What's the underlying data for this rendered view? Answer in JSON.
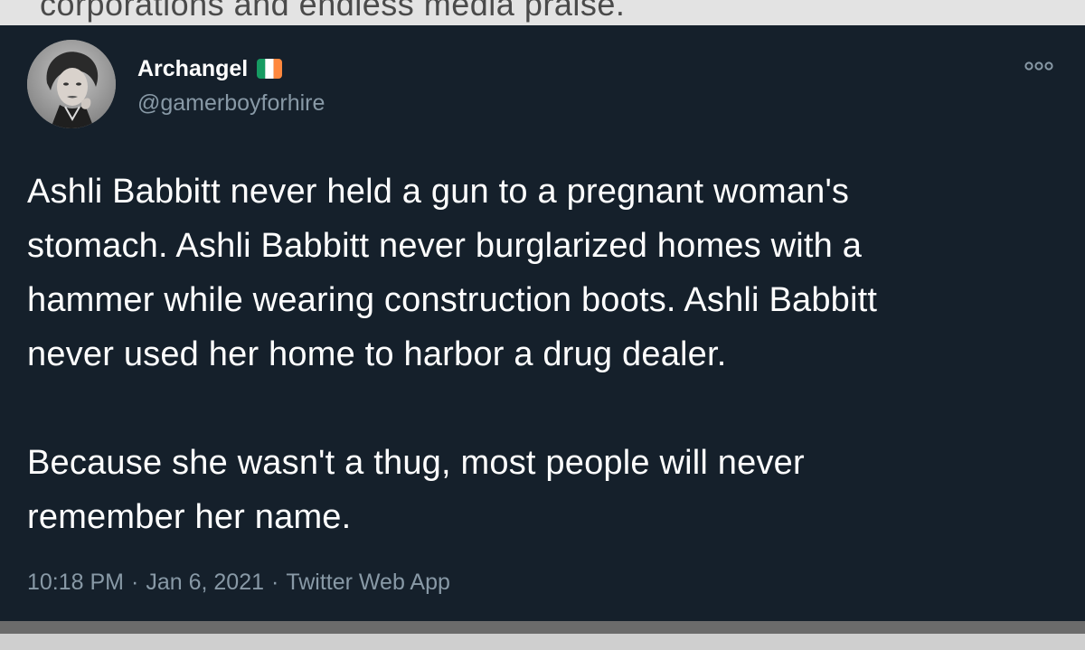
{
  "background_fragment": {
    "text": "corporations and endless media praise."
  },
  "tweet": {
    "author": {
      "display_name": "Archangel",
      "handle": "@gamerboyforhire",
      "flag": "ireland-flag"
    },
    "more_icon": "more-options-icon",
    "body_lines_p1": [
      "Ashli Babbitt never held a gun to a pregnant woman's",
      "stomach. Ashli Babbitt never burglarized homes with a",
      "hammer while wearing construction boots. Ashli Babbitt",
      "never used her home to harbor a drug dealer."
    ],
    "body_lines_p2": [
      "Because she wasn't a thug, most people will never",
      "remember her name."
    ],
    "meta": {
      "time": "10:18 PM",
      "separator": "·",
      "date": "Jan 6, 2021",
      "source": "Twitter Web App"
    }
  },
  "colors": {
    "card_background": "#15202b",
    "primary_text": "#ffffff",
    "secondary_text": "#8899a6",
    "flag_green": "#169b62",
    "flag_white": "#ffffff",
    "flag_orange": "#ff883e"
  }
}
